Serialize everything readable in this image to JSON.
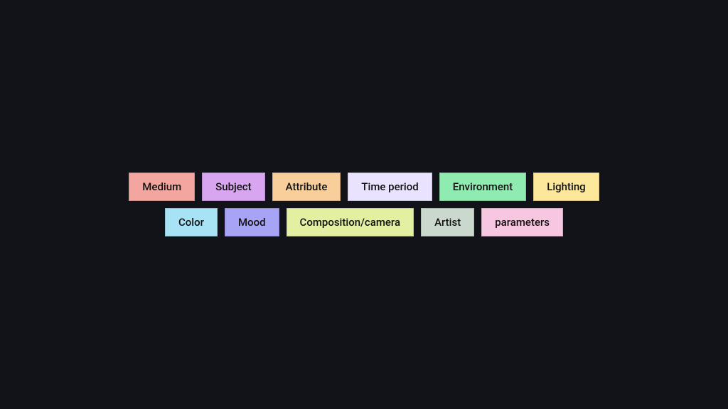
{
  "tags": [
    {
      "label": "Medium",
      "color": "#f3a6a0"
    },
    {
      "label": "Subject",
      "color": "#d8a6f0"
    },
    {
      "label": "Attribute",
      "color": "#f8ce9a"
    },
    {
      "label": "Time period",
      "color": "#eae3ff"
    },
    {
      "label": "Environment",
      "color": "#8febb0"
    },
    {
      "label": "Lighting",
      "color": "#fce79a"
    },
    {
      "label": "Color",
      "color": "#a8e2f5"
    },
    {
      "label": "Mood",
      "color": "#a8a4f5"
    },
    {
      "label": "Composition/camera",
      "color": "#e4f0a1"
    },
    {
      "label": "Artist",
      "color": "#cad8cd"
    },
    {
      "label": "parameters",
      "color": "#f7c6e0"
    }
  ]
}
